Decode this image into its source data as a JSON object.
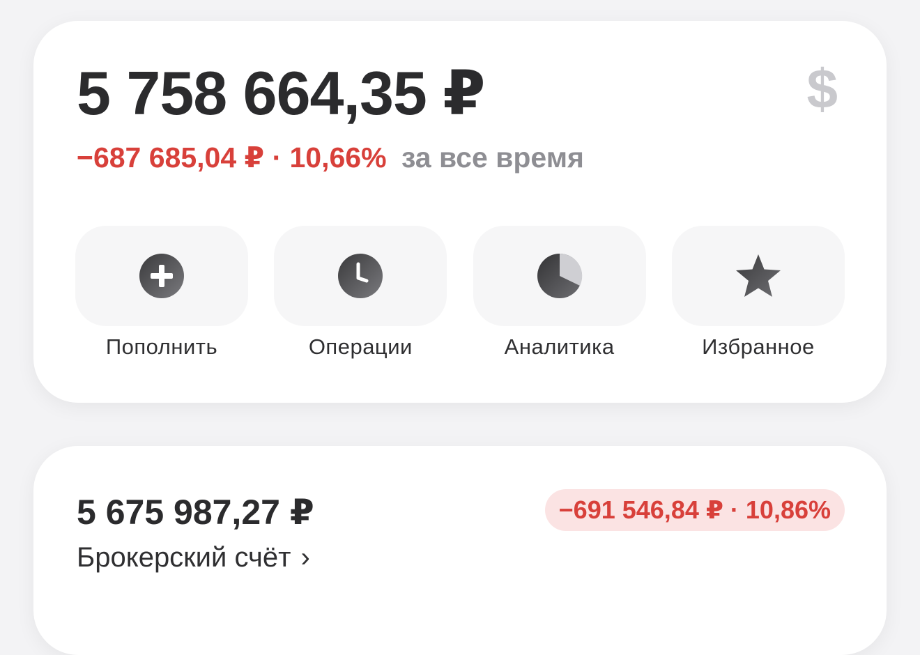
{
  "portfolio": {
    "total_value": "5 758 664,35 ₽",
    "currency_switch_symbol": "$",
    "change_value": "−687 685,04 ₽ · 10,66%",
    "change_period": "за все время",
    "negative_color": "#d8403a"
  },
  "actions": [
    {
      "label": "Пополнить",
      "icon": "plus-circle-icon"
    },
    {
      "label": "Операции",
      "icon": "clock-icon"
    },
    {
      "label": "Аналитика",
      "icon": "pie-chart-icon"
    },
    {
      "label": "Избранное",
      "icon": "star-icon"
    }
  ],
  "account": {
    "amount": "5 675 987,27 ₽",
    "name": "Брокерский счёт",
    "chevron": "›",
    "change_badge": "−691 546,84 ₽ · 10,86%"
  }
}
